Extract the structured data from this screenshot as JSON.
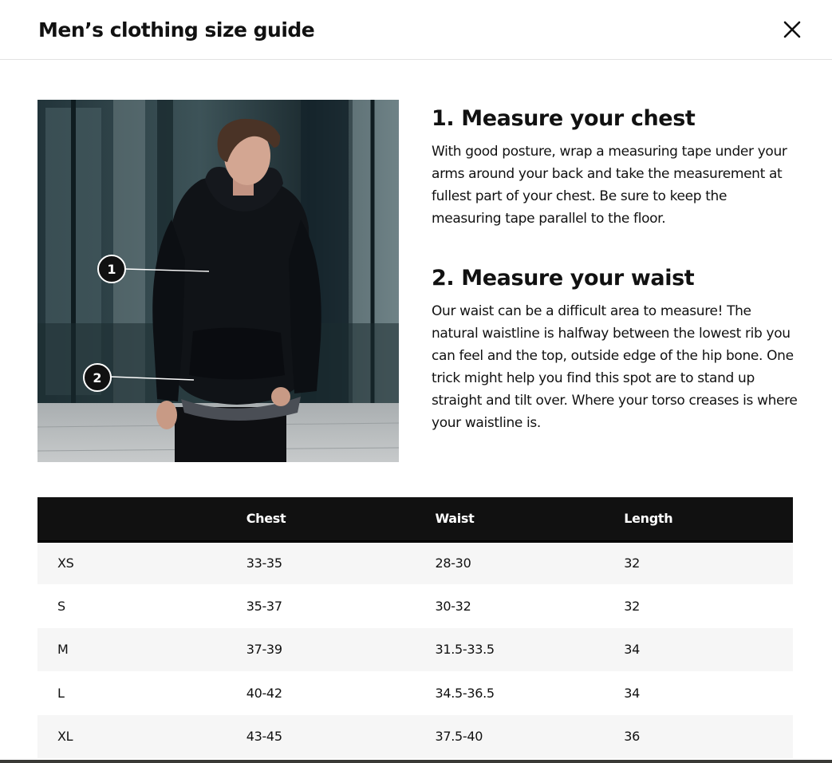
{
  "header": {
    "title": "Men’s clothing size guide"
  },
  "icons": {
    "close": "close-icon"
  },
  "photo": {
    "markers": [
      "1",
      "2"
    ]
  },
  "steps": [
    {
      "heading": "1. Measure your chest",
      "text": "With good posture, wrap a measuring tape under your arms around your back and take the measurement at fullest part of your chest. Be sure to keep the measuring tape parallel to the floor."
    },
    {
      "heading": "2. Measure your waist",
      "text": "Our waist can be a difficult area to measure! The natural waistline is halfway between the lowest rib you can feel and the top, outside edge of the hip bone. One trick might help you find this spot are to stand up straight and tilt over. Where your torso creases is where your waistline is."
    }
  ],
  "table": {
    "headers": [
      "",
      "Chest",
      "Waist",
      "Length"
    ],
    "rows": [
      [
        "XS",
        "33-35",
        "28-30",
        "32"
      ],
      [
        "S",
        "35-37",
        "30-32",
        "32"
      ],
      [
        "M",
        "37-39",
        "31.5-33.5",
        "34"
      ],
      [
        "L",
        "40-42",
        "34.5-36.5",
        "34"
      ],
      [
        "XL",
        "43-45",
        "37.5-40",
        "36"
      ]
    ]
  },
  "colors": {
    "table_header_bg": "#111111",
    "row_stripe": "#f6f6f6",
    "text": "#111111"
  }
}
